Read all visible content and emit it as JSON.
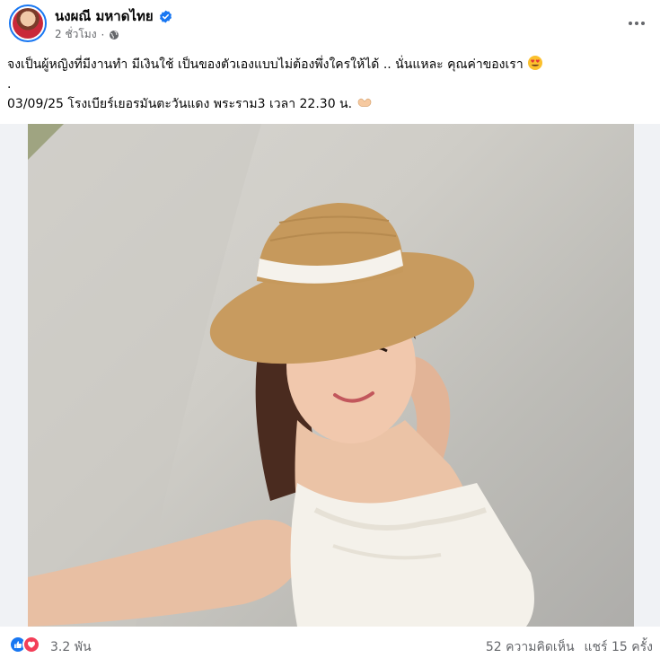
{
  "author": {
    "name": "นงผณี มหาดไทย",
    "verified": true
  },
  "meta": {
    "time": "2 ชั่วโมง",
    "separator": "·",
    "audience_icon": "globe-icon"
  },
  "caption": {
    "line1": "จงเป็นผู้หญิงที่มีงานทำ มีเงินใช้ เป็นของตัวเองแบบไม่ต้องพึ่งใครให้ได้ .. นั่นแหละ คุณค่าของเรา",
    "line1_emoji": "heart-eyes-emoji",
    "line2": ".",
    "line3": "03/09/25 โรงเบียร์เยอรมันตะวันแดง พระราม3 เวลา 22.30 น.",
    "line3_emoji": "heart-hands-emoji"
  },
  "reactions": {
    "icons": [
      "like-icon",
      "love-icon"
    ],
    "count": "3.2 พัน"
  },
  "stats": {
    "comments": "52 ความคิดเห็น",
    "shares": "แชร์ 15 ครั้ง"
  },
  "colors": {
    "brand_blue": "#1877f2",
    "love_red": "#f33e58",
    "secondary_text": "#65676b"
  }
}
